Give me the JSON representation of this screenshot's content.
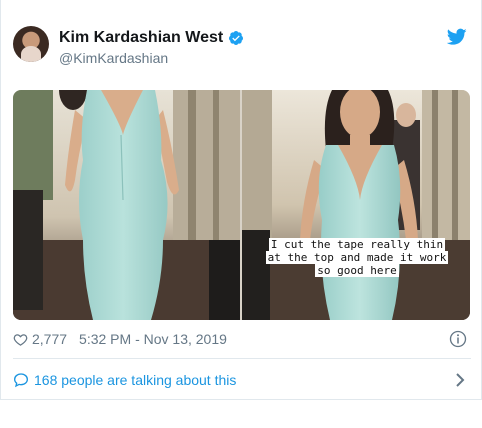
{
  "tweet": {
    "display_name": "Kim Kardashian West",
    "handle": "@KimKardashian",
    "verified": true,
    "icons": {
      "verified": "verified-badge-icon",
      "brand": "twitter-bird-icon",
      "like": "heart-icon",
      "info": "info-icon",
      "conversation": "speech-bubble-icon",
      "more": "chevron-right-icon"
    },
    "colors": {
      "brand": "#1da1f2",
      "link": "#1b95e0",
      "muted": "#657786"
    }
  },
  "media": {
    "caption_lines": [
      "I cut the tape really thin",
      "at the top and made it work",
      "so good here"
    ]
  },
  "stats": {
    "likes": "2,777",
    "time": "5:32 PM - Nov 13, 2019"
  },
  "conversation": {
    "label": "168 people are talking about this"
  }
}
